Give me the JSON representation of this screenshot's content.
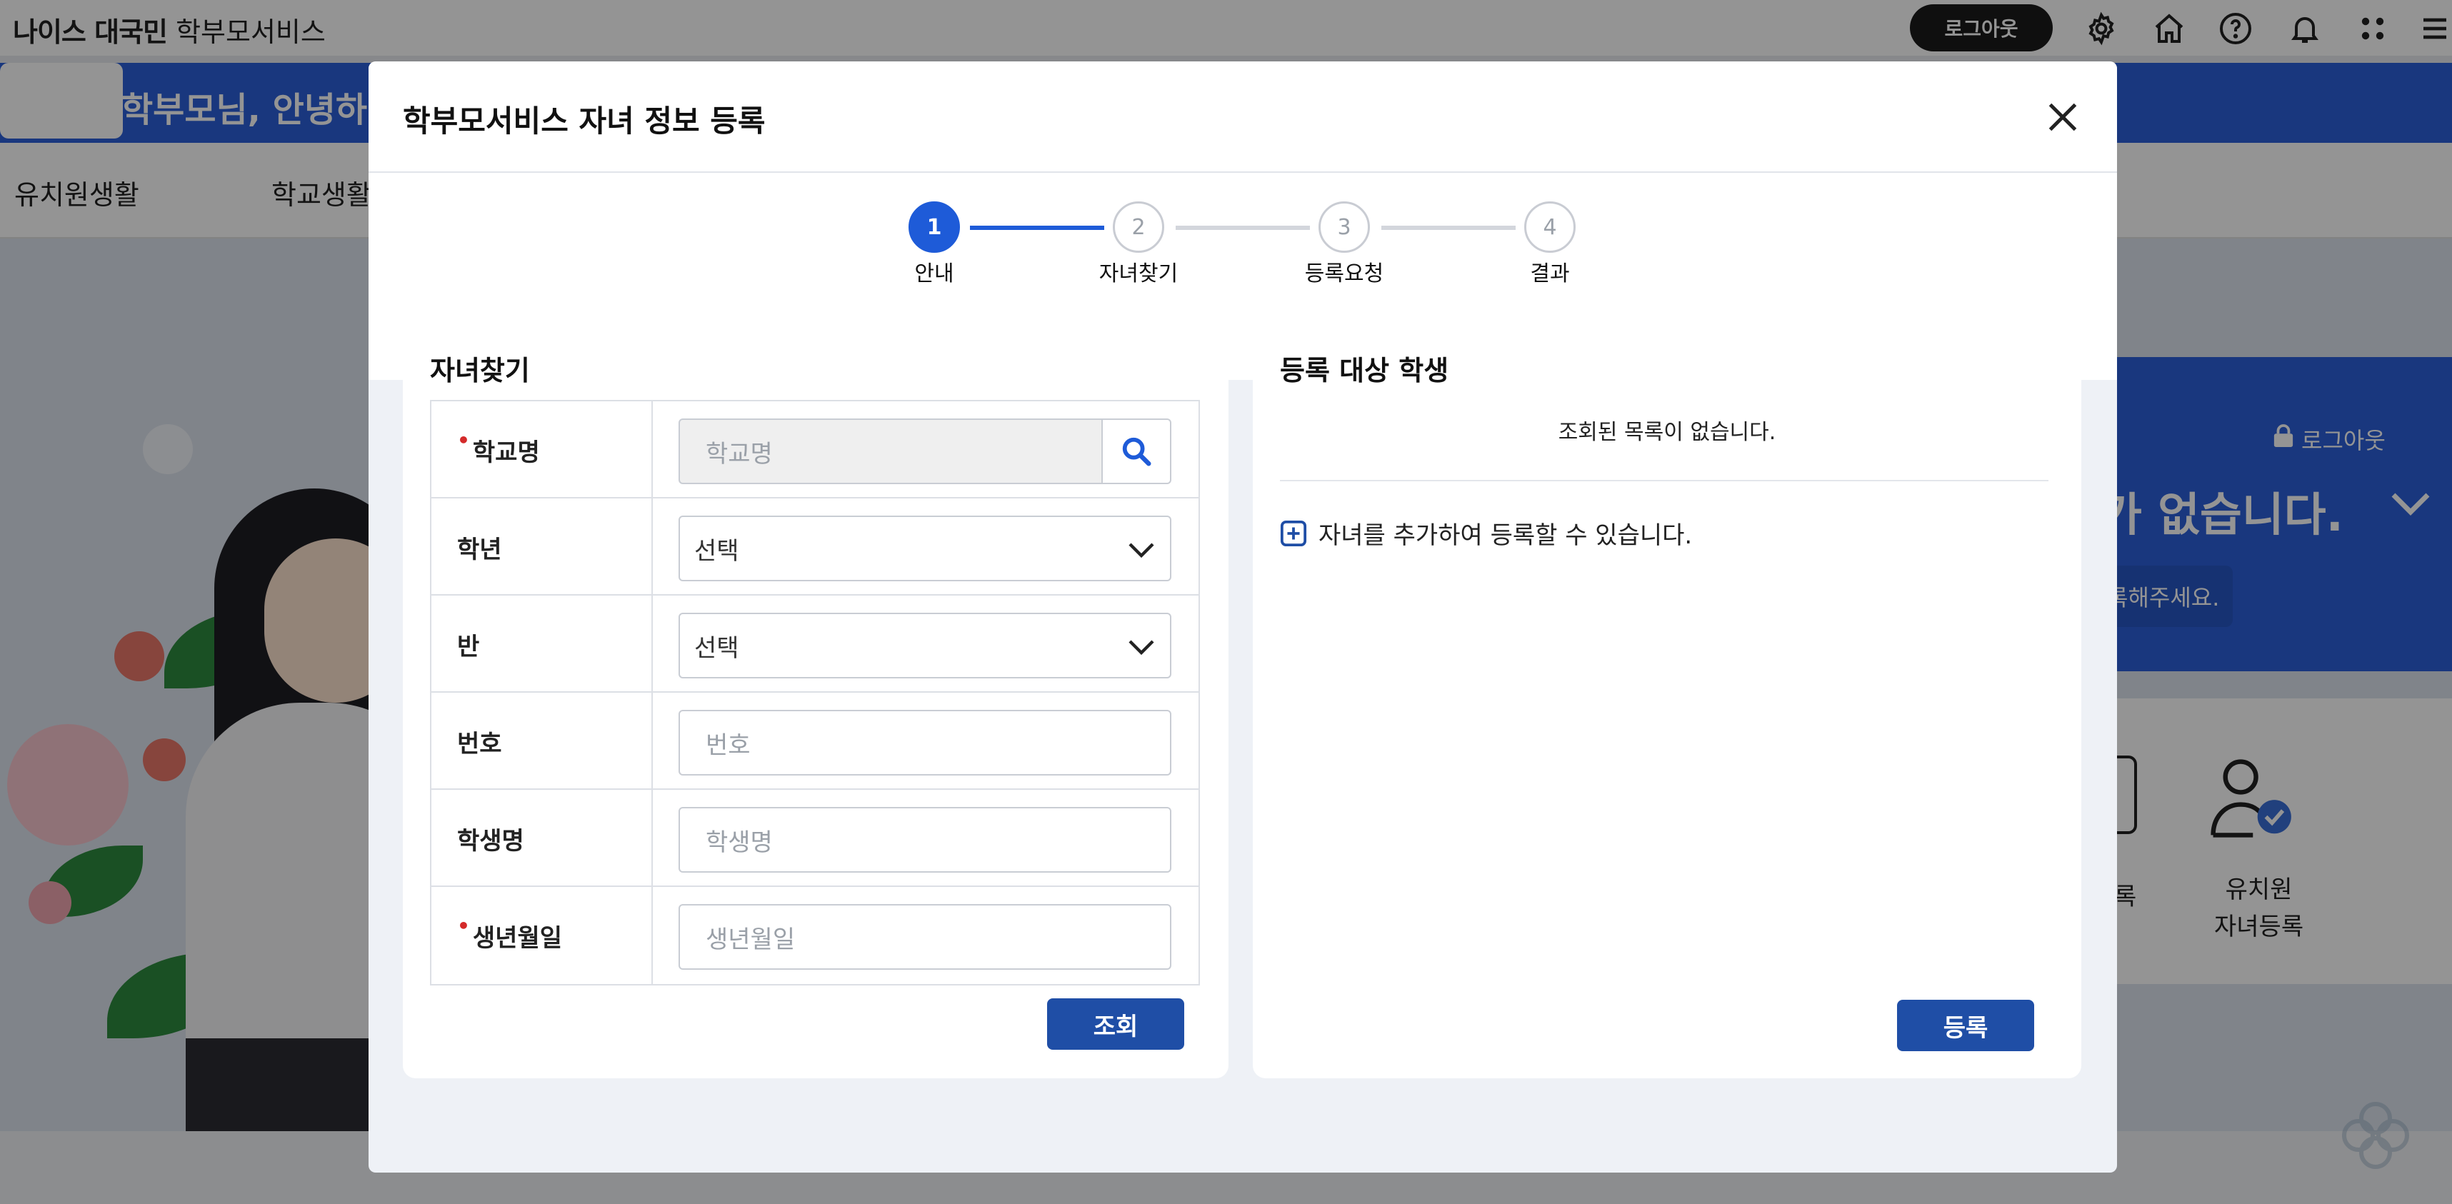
{
  "topbar": {
    "logo_brand": "나이스 대국민",
    "logo_service": "학부모서비스",
    "logout_label": "로그아웃",
    "icons": [
      "gear-icon",
      "home-icon",
      "help-icon",
      "bell-icon",
      "apps-icon",
      "menu-icon"
    ]
  },
  "welcome": {
    "text": "학부모님, 안녕하"
  },
  "nav": {
    "items": [
      "유치원생활",
      "학교생활"
    ]
  },
  "background_right": {
    "logout_label": "로그아웃",
    "headline": "가 없습니다.",
    "pill_text": "록해주세요.",
    "card_left_tail": "록",
    "card_right_line1": "유치원",
    "card_right_line2": "자녀등록"
  },
  "modal": {
    "title": "학부모서비스 자녀 정보 등록",
    "steps": [
      {
        "number": "1",
        "label": "안내",
        "active": true
      },
      {
        "number": "2",
        "label": "자녀찾기",
        "active": false
      },
      {
        "number": "3",
        "label": "등록요청",
        "active": false
      },
      {
        "number": "4",
        "label": "결과",
        "active": false
      }
    ],
    "find_panel": {
      "title": "자녀찾기",
      "fields": {
        "school": {
          "label": "학교명",
          "required": true,
          "placeholder": "학교명"
        },
        "grade": {
          "label": "학년",
          "required": false,
          "value": "선택"
        },
        "class": {
          "label": "반",
          "required": false,
          "value": "선택"
        },
        "number": {
          "label": "번호",
          "required": false,
          "placeholder": "번호"
        },
        "student_name": {
          "label": "학생명",
          "required": false,
          "placeholder": "학생명"
        },
        "birthdate": {
          "label": "생년월일",
          "required": true,
          "placeholder": "생년월일"
        }
      },
      "search_button": "조회"
    },
    "target_panel": {
      "title": "등록 대상 학생",
      "empty_message": "조회된 목록이 없습니다.",
      "add_hint": "자녀를 추가하여 등록할 수 있습니다.",
      "register_button": "등록"
    }
  },
  "colors": {
    "primary_blue": "#1e5bd8",
    "button_navy": "#1f4ea6",
    "banner_blue": "#2b5fd9",
    "required_red": "#d42a2a"
  }
}
